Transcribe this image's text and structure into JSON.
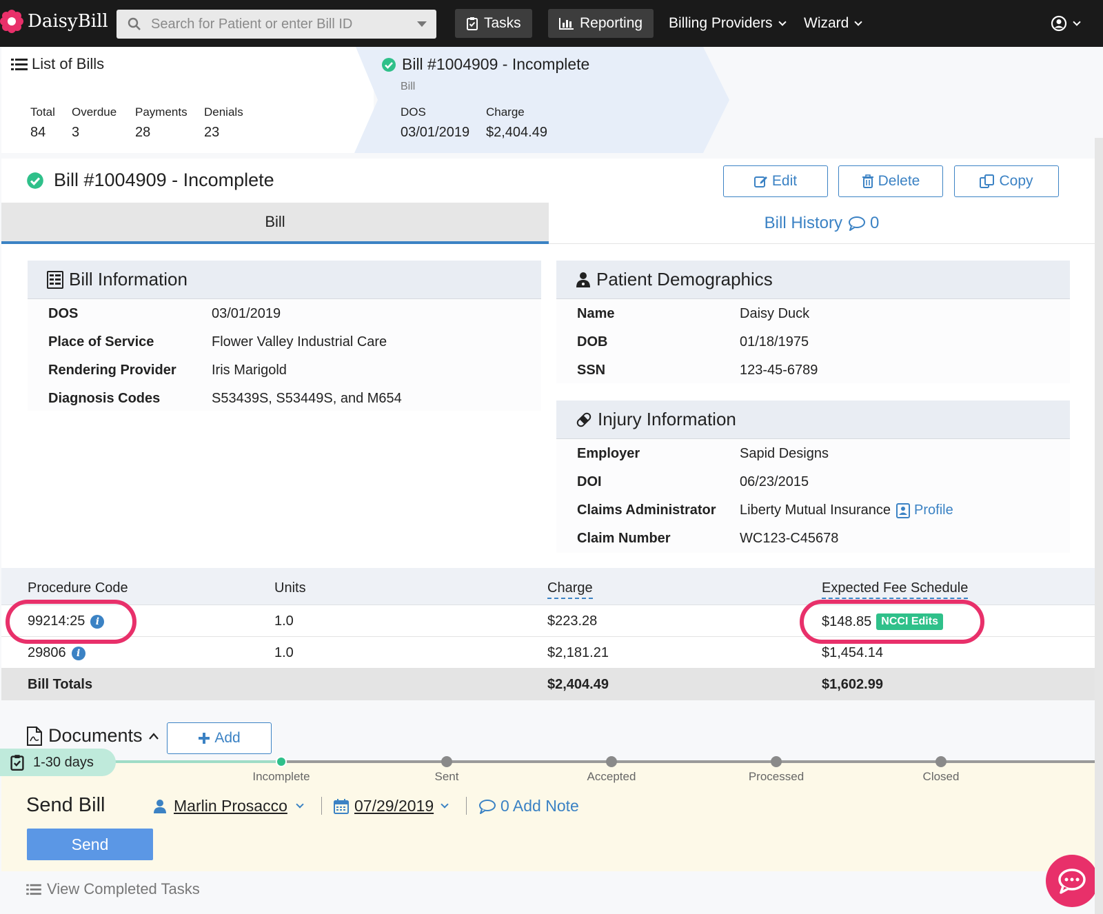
{
  "app": {
    "name": "DaisyBill"
  },
  "nav": {
    "search_placeholder": "Search for Patient or enter Bill ID",
    "tasks": "Tasks",
    "reporting": "Reporting",
    "billing_providers": "Billing Providers",
    "wizard": "Wizard"
  },
  "breadcrumb": {
    "list_title": "List of Bills",
    "stats": [
      {
        "label": "Total",
        "value": "84"
      },
      {
        "label": "Overdue",
        "value": "3"
      },
      {
        "label": "Payments",
        "value": "28"
      },
      {
        "label": "Denials",
        "value": "23"
      }
    ],
    "bill_title": "Bill #1004909 - Incomplete",
    "bill_sub": "Bill",
    "dos_label": "DOS",
    "dos_value": "03/01/2019",
    "charge_label": "Charge",
    "charge_value": "$2,404.49"
  },
  "page": {
    "title": "Bill #1004909 - Incomplete",
    "edit": "Edit",
    "delete": "Delete",
    "copy": "Copy"
  },
  "tabs": {
    "bill": "Bill",
    "history": "Bill History",
    "history_count": "0"
  },
  "bill_info": {
    "title": "Bill Information",
    "rows": [
      {
        "label": "DOS",
        "value": "03/01/2019"
      },
      {
        "label": "Place of Service",
        "value": "Flower Valley Industrial Care"
      },
      {
        "label": "Rendering Provider",
        "value": "Iris Marigold"
      },
      {
        "label": "Diagnosis Codes",
        "value": "S53439S, S53449S, and M654"
      }
    ]
  },
  "patient": {
    "title": "Patient Demographics",
    "rows": [
      {
        "label": "Name",
        "value": "Daisy Duck"
      },
      {
        "label": "DOB",
        "value": "01/18/1975"
      },
      {
        "label": "SSN",
        "value": "123-45-6789"
      }
    ]
  },
  "injury": {
    "title": "Injury Information",
    "rows": [
      {
        "label": "Employer",
        "value": "Sapid Designs"
      },
      {
        "label": "DOI",
        "value": "06/23/2015"
      },
      {
        "label": "Claims Administrator",
        "value": "Liberty Mutual Insurance"
      },
      {
        "label": "Claim Number",
        "value": "WC123-C45678"
      }
    ],
    "profile_link": "Profile"
  },
  "procedures": {
    "headers": {
      "code": "Procedure Code",
      "units": "Units",
      "charge": "Charge",
      "expected": "Expected Fee Schedule"
    },
    "rows": [
      {
        "code": "99214:25",
        "units": "1.0",
        "charge": "$223.28",
        "expected": "$148.85",
        "badge": "NCCI Edits"
      },
      {
        "code": "29806",
        "units": "1.0",
        "charge": "$2,181.21",
        "expected": "$1,454.14"
      }
    ],
    "totals": {
      "label": "Bill Totals",
      "charge": "$2,404.49",
      "expected": "$1,602.99"
    }
  },
  "documents": {
    "title": "Documents",
    "add": "Add"
  },
  "progress": {
    "days": "1-30 days",
    "steps": [
      "Incomplete",
      "Sent",
      "Accepted",
      "Processed",
      "Closed"
    ]
  },
  "send": {
    "title": "Send Bill",
    "assignee": "Marlin Prosacco",
    "date": "07/29/2019",
    "note": "0 Add Note",
    "button": "Send"
  },
  "footer": {
    "completed": "View Completed Tasks"
  },
  "colors": {
    "accent": "#3b82c4",
    "success": "#2fc08a",
    "highlight": "#e8306a",
    "nav_bg": "#1a1a1a"
  }
}
